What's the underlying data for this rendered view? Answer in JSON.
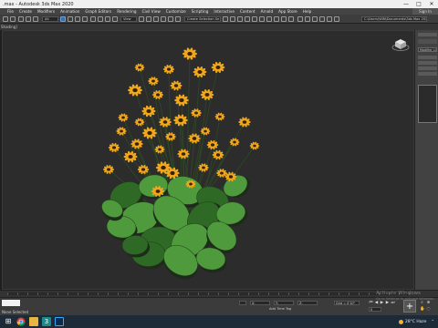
{
  "window": {
    "title": ".max - Autodesk 3ds Max 2020",
    "controls": [
      "—",
      "□",
      "✕"
    ]
  },
  "menu": {
    "items": [
      "File",
      "Create",
      "Modifiers",
      "Animation",
      "Graph Editors",
      "Rendering",
      "Civil View",
      "Customize",
      "Scripting",
      "Interactive",
      "Content",
      "Arnold",
      "App Store",
      "Help"
    ],
    "sign_in": "Sign In"
  },
  "toolbar": {
    "filter_value": "All",
    "view_value": "View",
    "selection_set_value": "Create Selection Se",
    "project_path": "C:\\Users\\WIN\\Documents\\3ds Max 2020"
  },
  "viewport": {
    "label": "[+] [Perspective] [Standard] [Default Shading]",
    "label_short": "Shading]"
  },
  "command_panel": {
    "modifier_list_label": "Modifier List"
  },
  "status": {
    "selection_text": "1 Object Selected",
    "prompt": "None Selected",
    "x_label": "X:",
    "y_label": "Y:",
    "z_label": "Z:",
    "grid": "Grid = 0'10\"",
    "add_time_tag": "Add Time Tag",
    "auto_key": "Auto Key",
    "set_key": "Set Key",
    "frame": "0",
    "selected": "Selected"
  },
  "watermark": {
    "line1": "Activate Windows",
    "line2": "Go to Settings to activate Windows."
  },
  "taskbar": {
    "temperature": "28°C",
    "weather": "Haze",
    "icons": [
      "windows-icon",
      "chrome-icon",
      "folder-icon",
      "3dsmax-icon",
      "photoshop-icon"
    ]
  },
  "colors": {
    "petal": "#f0a81c",
    "center": "#3a2108",
    "leaf": "#4f9a3c",
    "leaf_dark": "#2e6a26"
  }
}
